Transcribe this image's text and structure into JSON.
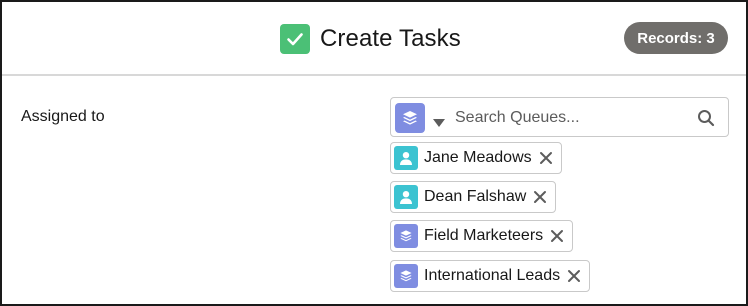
{
  "header": {
    "title": "Create Tasks",
    "title_icon": "checkbox-icon",
    "records_badge": "Records: 3"
  },
  "form": {
    "assigned_label": "Assigned to",
    "search": {
      "placeholder": "Search Queues...",
      "value": "",
      "type_icon": "queue-icon"
    },
    "pills": [
      {
        "label": "Jane Meadows",
        "type": "user"
      },
      {
        "label": "Dean Falshaw",
        "type": "user"
      },
      {
        "label": "Field Marketeers",
        "type": "queue"
      },
      {
        "label": "International Leads",
        "type": "queue"
      }
    ]
  },
  "colors": {
    "check_green": "#4bc076",
    "badge_gray": "#706e6b",
    "user_teal": "#3cc3d1",
    "queue_purple": "#7f8de1"
  }
}
